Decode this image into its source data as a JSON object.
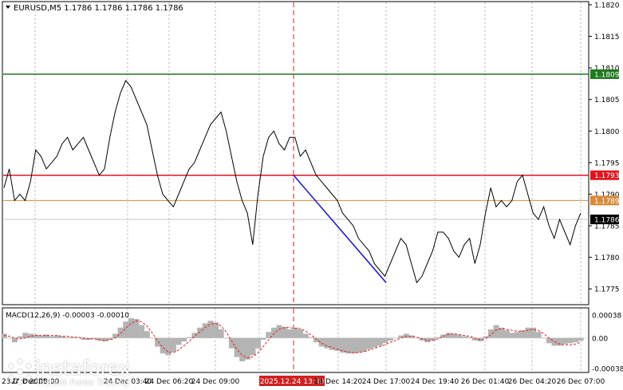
{
  "header": {
    "symbol_line": "EURUSD,M5  1.1786 1.1786 1.1786 1.1786"
  },
  "macd": {
    "label": "MACD(12,26,9) -0.00003 -0.00010"
  },
  "colors": {
    "price_line": "#000000",
    "green_level": "#1e7a1e",
    "red_level": "#e0141e",
    "orange_level": "#d88a3a",
    "current_badge": "#000000",
    "trend_line": "#2020d0",
    "macd_hist": "#b4b4b4",
    "macd_signal": "#e02020",
    "grid": "#b0b0b0",
    "vline": "#d02020"
  },
  "watermark": {
    "name": "instaforex",
    "tagline": "Instant Forex Trading",
    "icon": "instaforex-logo-icon"
  },
  "chart_data": {
    "type": "line",
    "title": "EURUSD,M5  1.1786 1.1786 1.1786 1.1786",
    "xlabel": "",
    "ylabel": "",
    "ylim": [
      1.17725,
      1.18205
    ],
    "y_ticks": [
      "1.1820",
      "1.1815",
      "1.1810",
      "1.1805",
      "1.1800",
      "1.1795",
      "1.1790",
      "1.1785",
      "1.1780",
      "1.1775"
    ],
    "x_ticks": [
      "23 Dec 2025",
      "24 Dec 00:00",
      "24 Dec 03:40",
      "24 Dec 06:20",
      "24 Dec 09:00",
      "2025.12.24 13:30",
      "24 Dec 14:20",
      "24 Dec 17:00",
      "24 Dec 19:40",
      "26 Dec 01:40",
      "26 Dec 04:20",
      "26 Dec 07:00"
    ],
    "highlighted_x_label": "2025.12.24 13:30",
    "levels": [
      {
        "value": 1.1809,
        "label": "1.1809",
        "color": "#1e7a1e"
      },
      {
        "value": 1.1793,
        "label": "1.1793",
        "color": "#e0141e"
      },
      {
        "value": 1.1789,
        "label": "1.1789",
        "color": "#d88a3a"
      },
      {
        "value": 1.1786,
        "label": "1.1786",
        "color": "#000000"
      }
    ],
    "series": [
      {
        "values": [
          1.1791,
          1.1794,
          1.1789,
          1.179,
          1.1789,
          1.1792,
          1.1797,
          1.1796,
          1.1794,
          1.1795,
          1.1796,
          1.1798,
          1.1799,
          1.1797,
          1.1798,
          1.1799,
          1.1797,
          1.1795,
          1.1793,
          1.1794,
          1.1799,
          1.1803,
          1.1806,
          1.1808,
          1.1807,
          1.1805,
          1.1803,
          1.1801,
          1.1797,
          1.1793,
          1.179,
          1.1789,
          1.1788,
          1.179,
          1.1792,
          1.1794,
          1.1795,
          1.1797,
          1.1799,
          1.1801,
          1.1802,
          1.1803,
          1.18,
          1.1796,
          1.1792,
          1.1789,
          1.1787,
          1.1782,
          1.179,
          1.1796,
          1.1799,
          1.18,
          1.1798,
          1.1797,
          1.1799,
          1.1799,
          1.1796,
          1.1797,
          1.1795,
          1.1793,
          1.1792,
          1.1791,
          1.179,
          1.1789,
          1.1787,
          1.1786,
          1.1785,
          1.1783,
          1.1782,
          1.1781,
          1.1779,
          1.1778,
          1.1777,
          1.1779,
          1.1781,
          1.1783,
          1.1782,
          1.1779,
          1.1776,
          1.1777,
          1.1779,
          1.1781,
          1.1784,
          1.1784,
          1.1783,
          1.1781,
          1.178,
          1.1782,
          1.1783,
          1.1779,
          1.1782,
          1.1787,
          1.1791,
          1.1788,
          1.1789,
          1.1788,
          1.1789,
          1.1792,
          1.1793,
          1.179,
          1.1787,
          1.1786,
          1.1788,
          1.1785,
          1.1783,
          1.1786,
          1.1784,
          1.1782,
          1.1785,
          1.1787
        ]
      }
    ],
    "trend_line": {
      "from_value": 1.1793,
      "to_value": 1.1776
    },
    "macd": {
      "ylim": [
        -0.0004,
        0.00035
      ],
      "y_ticks": [
        "0.00038",
        "0.00",
        "-0.00038"
      ],
      "histogram": [
        5e-05,
        0.0,
        -5e-05,
        2e-05,
        6e-05,
        5e-05,
        4e-05,
        3e-05,
        4e-05,
        2e-05,
        3e-05,
        2e-05,
        1e-05,
        1e-05,
        0.0,
        -2e-05,
        -2e-05,
        -1e-05,
        -3e-05,
        -4e-05,
        -2e-05,
        5e-05,
        0.00012,
        0.00019,
        0.00023,
        0.00022,
        0.00015,
        8e-05,
        0.0,
        -0.0001,
        -0.00018,
        -0.0002,
        -0.00016,
        -8e-05,
        -4e-05,
        1e-05,
        6e-05,
        0.00012,
        0.00017,
        0.0002,
        0.00018,
        0.0001,
        0.0,
        -0.00012,
        -0.00022,
        -0.00027,
        -0.00025,
        -0.0002,
        -0.00012,
        -2e-05,
        7e-05,
        0.00012,
        0.00015,
        0.00013,
        0.0001,
        0.00012,
        0.0001,
        5e-05,
        1e-05,
        -5e-05,
        -0.0001,
        -0.00012,
        -0.00014,
        -0.00015,
        -0.00017,
        -0.00018,
        -0.00018,
        -0.00017,
        -0.00016,
        -0.00013,
        -0.00011,
        -9e-05,
        -6e-05,
        -3e-05,
        0.0,
        3e-05,
        5e-05,
        3e-05,
        0.0,
        -3e-05,
        -5e-05,
        -3e-05,
        1e-05,
        4e-05,
        6e-05,
        5e-05,
        4e-05,
        2e-05,
        1e-05,
        -3e-05,
        -4e-05,
        2e-05,
        0.0001,
        0.00015,
        0.00012,
        9e-05,
        6e-05,
        7e-05,
        9e-05,
        0.00012,
        0.00012,
        7e-05,
        0.0,
        -6e-05,
        -9e-05,
        -9e-05,
        -7e-05,
        -6e-05,
        -5e-05,
        -3e-05
      ],
      "signal": [
        3e-05,
        2e-05,
        0.0,
        -1e-05,
        0.0,
        2e-05,
        3e-05,
        3e-05,
        3e-05,
        3e-05,
        3e-05,
        2e-05,
        2e-05,
        1e-05,
        1e-05,
        0.0,
        -1e-05,
        -1e-05,
        -2e-05,
        -3e-05,
        -2e-05,
        0.0,
        5e-05,
        0.00011,
        0.00017,
        0.0002,
        0.00019,
        0.00014,
        6e-05,
        -3e-05,
        -0.00011,
        -0.00016,
        -0.00017,
        -0.00014,
        -9e-05,
        -4e-05,
        2e-05,
        7e-05,
        0.00012,
        0.00016,
        0.00017,
        0.00014,
        7e-05,
        -3e-05,
        -0.00013,
        -0.0002,
        -0.00023,
        -0.00022,
        -0.00017,
        -0.0001,
        -2e-05,
        5e-05,
        0.0001,
        0.00012,
        0.00012,
        0.00011,
        0.00011,
        8e-05,
        4e-05,
        -1e-05,
        -6e-05,
        -9e-05,
        -0.00011,
        -0.00013,
        -0.00015,
        -0.00016,
        -0.00017,
        -0.00017,
        -0.00016,
        -0.00014,
        -0.00012,
        -0.0001,
        -8e-05,
        -5e-05,
        -3e-05,
        0.0,
        2e-05,
        2e-05,
        1e-05,
        -1e-05,
        -3e-05,
        -3e-05,
        -1e-05,
        2e-05,
        4e-05,
        5e-05,
        4e-05,
        3e-05,
        2e-05,
        0.0,
        -2e-05,
        -1e-05,
        4e-05,
        9e-05,
        0.00011,
        0.0001,
        9e-05,
        8e-05,
        8e-05,
        9e-05,
        0.0001,
        9e-05,
        5e-05,
        0.0,
        -4e-05,
        -7e-05,
        -8e-05,
        -8e-05,
        -7e-05,
        -5e-05
      ]
    }
  }
}
